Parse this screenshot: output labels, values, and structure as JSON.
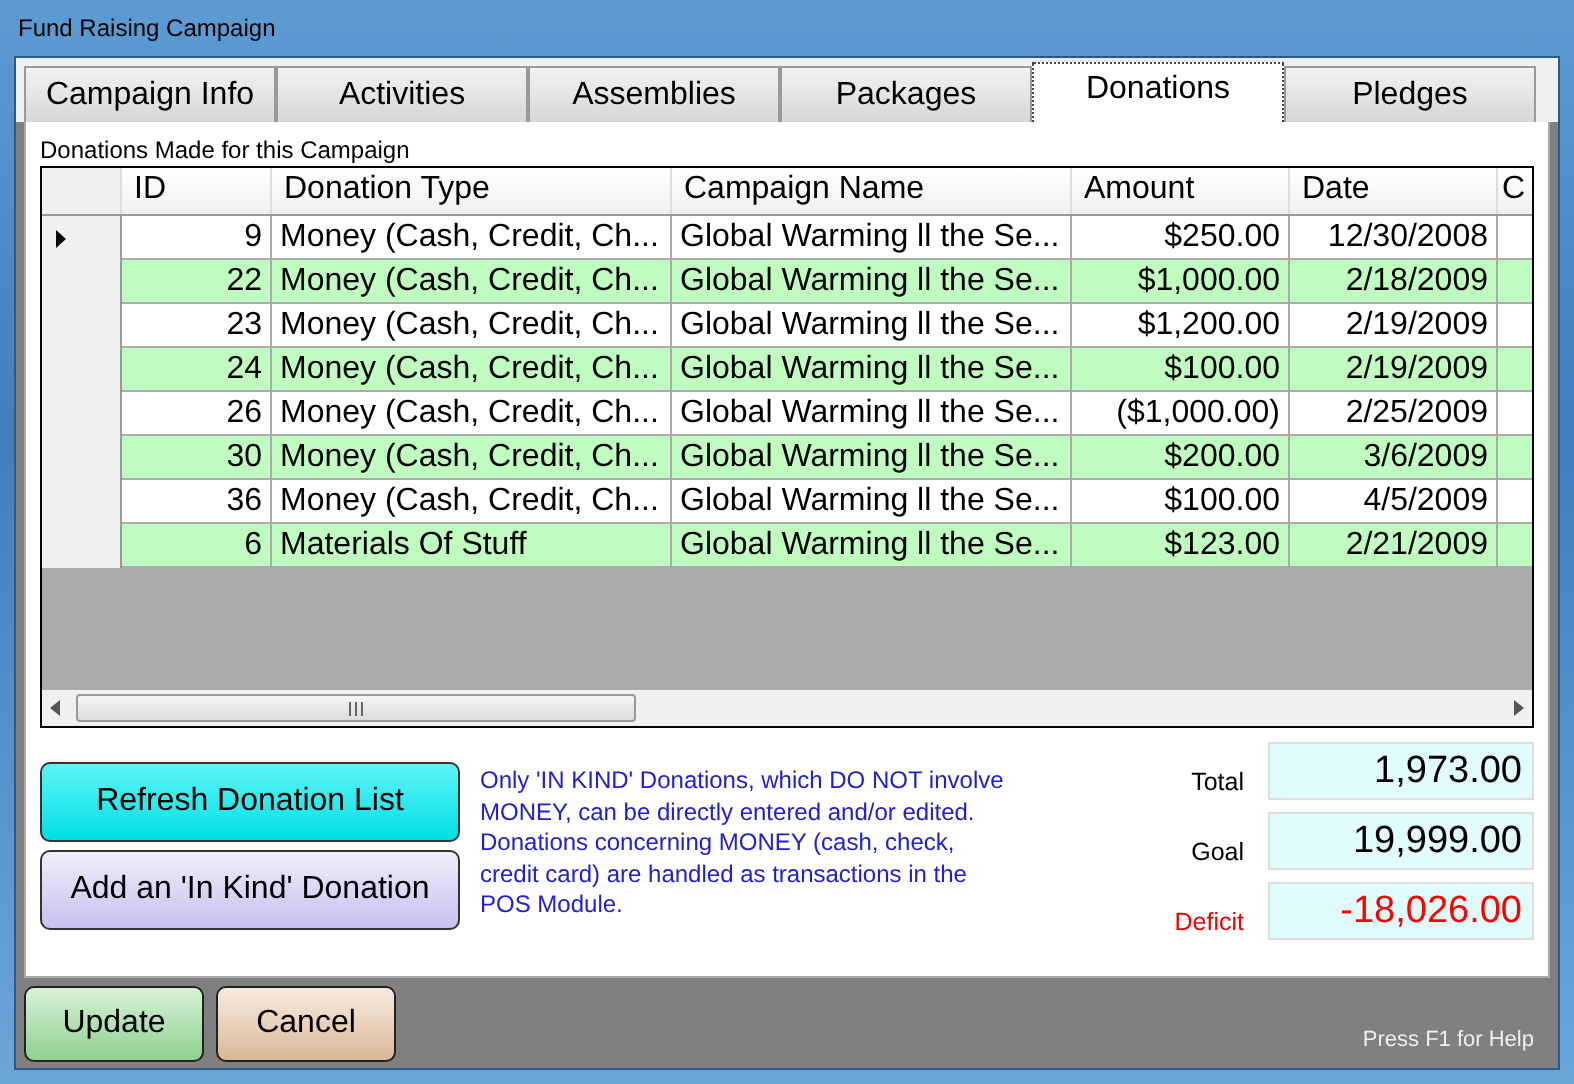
{
  "window": {
    "title": "Fund Raising Campaign"
  },
  "tabs": [
    {
      "label": "Campaign Info",
      "selected": false
    },
    {
      "label": "Activities",
      "selected": false
    },
    {
      "label": "Assemblies",
      "selected": false
    },
    {
      "label": "Packages",
      "selected": false
    },
    {
      "label": "Donations",
      "selected": true
    },
    {
      "label": "Pledges",
      "selected": false
    }
  ],
  "grid": {
    "caption": "Donations Made for this Campaign",
    "columns": [
      "ID",
      "Donation Type",
      "Campaign Name",
      "Amount",
      "Date",
      "C"
    ],
    "rows": [
      {
        "current": true,
        "cells": [
          "9",
          "Money (Cash, Credit, Ch...",
          "Global Warming ll the Se...",
          "$250.00",
          "12/30/2008"
        ]
      },
      {
        "current": false,
        "cells": [
          "22",
          "Money (Cash, Credit, Ch...",
          "Global Warming ll the Se...",
          "$1,000.00",
          "2/18/2009"
        ]
      },
      {
        "current": false,
        "cells": [
          "23",
          "Money (Cash, Credit, Ch...",
          "Global Warming ll the Se...",
          "$1,200.00",
          "2/19/2009"
        ]
      },
      {
        "current": false,
        "cells": [
          "24",
          "Money (Cash, Credit, Ch...",
          "Global Warming ll the Se...",
          "$100.00",
          "2/19/2009"
        ]
      },
      {
        "current": false,
        "cells": [
          "26",
          "Money (Cash, Credit, Ch...",
          "Global Warming ll the Se...",
          "($1,000.00)",
          "2/25/2009"
        ]
      },
      {
        "current": false,
        "cells": [
          "30",
          "Money (Cash, Credit, Ch...",
          "Global Warming ll the Se...",
          "$200.00",
          "3/6/2009"
        ]
      },
      {
        "current": false,
        "cells": [
          "36",
          "Money (Cash, Credit, Ch...",
          "Global Warming ll the Se...",
          "$100.00",
          "4/5/2009"
        ]
      },
      {
        "current": false,
        "cells": [
          "6",
          "Materials Of Stuff",
          "Global Warming ll the Se...",
          "$123.00",
          "2/21/2009"
        ]
      }
    ]
  },
  "actions": [
    {
      "label": "Refresh Donation List",
      "kind": "cyan"
    },
    {
      "label": "Add an 'In Kind' Donation",
      "kind": "lavender"
    }
  ],
  "note": "Only 'IN KIND' Donations, which DO NOT involve MONEY, can be directly entered and/or edited.  Donations concerning MONEY (cash, check, credit card) are handled as transactions in the POS Module.",
  "totals": [
    {
      "label": "Total",
      "value": "1,973.00",
      "alert": false
    },
    {
      "label": "Goal",
      "value": "19,999.00",
      "alert": false
    },
    {
      "label": "Deficit",
      "value": "-18,026.00",
      "alert": true
    }
  ],
  "footer": {
    "buttons": [
      {
        "label": "Update",
        "kind": "green"
      },
      {
        "label": "Cancel",
        "kind": "tan"
      }
    ],
    "help": "Press F1 for Help"
  }
}
